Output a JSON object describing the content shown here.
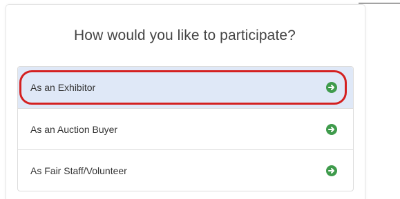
{
  "header": {
    "title": "How would you like to participate?"
  },
  "options": [
    {
      "label": "As an Exhibitor",
      "selected": true,
      "icon": "arrow-right-circle-icon"
    },
    {
      "label": "As an Auction Buyer",
      "selected": false,
      "icon": "arrow-right-circle-icon"
    },
    {
      "label": "As Fair Staff/Volunteer",
      "selected": false,
      "icon": "arrow-right-circle-icon"
    }
  ],
  "colors": {
    "selected_bg": "#dfe8f7",
    "arrow_icon": "#3f9b4c",
    "highlight_ring": "#d42020",
    "title_text": "#444444"
  }
}
